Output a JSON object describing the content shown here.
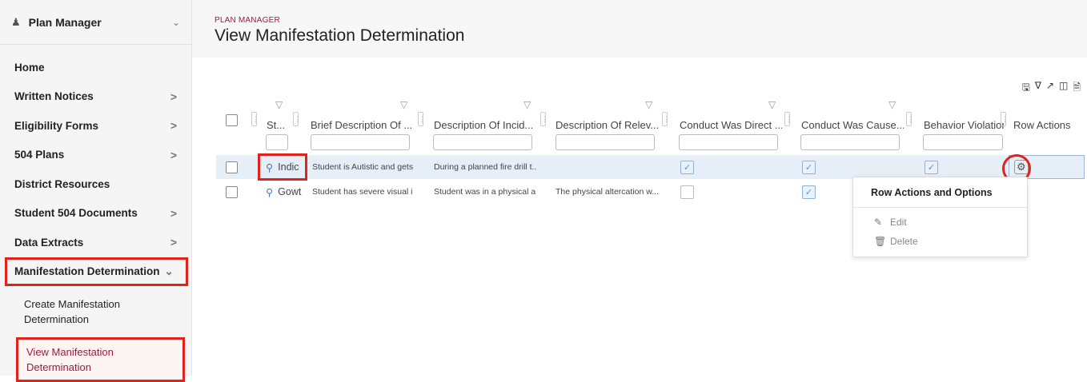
{
  "sidebar": {
    "header": "Plan Manager",
    "items": [
      {
        "label": "Home",
        "arrow": ""
      },
      {
        "label": "Written Notices",
        "arrow": ">"
      },
      {
        "label": "Eligibility Forms",
        "arrow": ">"
      },
      {
        "label": "504 Plans",
        "arrow": ">"
      },
      {
        "label": "District Resources",
        "arrow": ""
      },
      {
        "label": "Student 504 Documents",
        "arrow": ">"
      },
      {
        "label": "Data Extracts",
        "arrow": ">"
      },
      {
        "label": "Manifestation Determination",
        "arrow": "v"
      }
    ],
    "sub_items": [
      "Create Manifestation Determination",
      "View Manifestation Determination"
    ]
  },
  "page": {
    "breadcrumb": "PLAN MANAGER",
    "title": "View Manifestation Determination"
  },
  "toolbar_icons": [
    "save-icon",
    "filter-clear-icon",
    "expand-icon",
    "columns-icon",
    "export-icon"
  ],
  "table": {
    "headers": [
      "St...",
      "Brief Description Of ...",
      "Description Of Incid...",
      "Description Of Relev...",
      "Conduct Was Direct ...",
      "Conduct Was Cause...",
      "Behavior Violation",
      "Row Actions"
    ],
    "rows": [
      {
        "student": "Indic",
        "brief": "Student is Autistic and gets...",
        "incident": "During a planned fire drill t...",
        "relevant": "",
        "direct": true,
        "cause": true,
        "violation": true
      },
      {
        "student": "Gowt",
        "brief": "Student has severe visual i...",
        "incident": "Student was in a physical a...",
        "relevant": "The physical altercation w...",
        "direct": false,
        "cause": true,
        "violation": null
      }
    ]
  },
  "menu": {
    "title": "Row Actions and Options",
    "items": [
      "Edit",
      "Delete"
    ]
  }
}
